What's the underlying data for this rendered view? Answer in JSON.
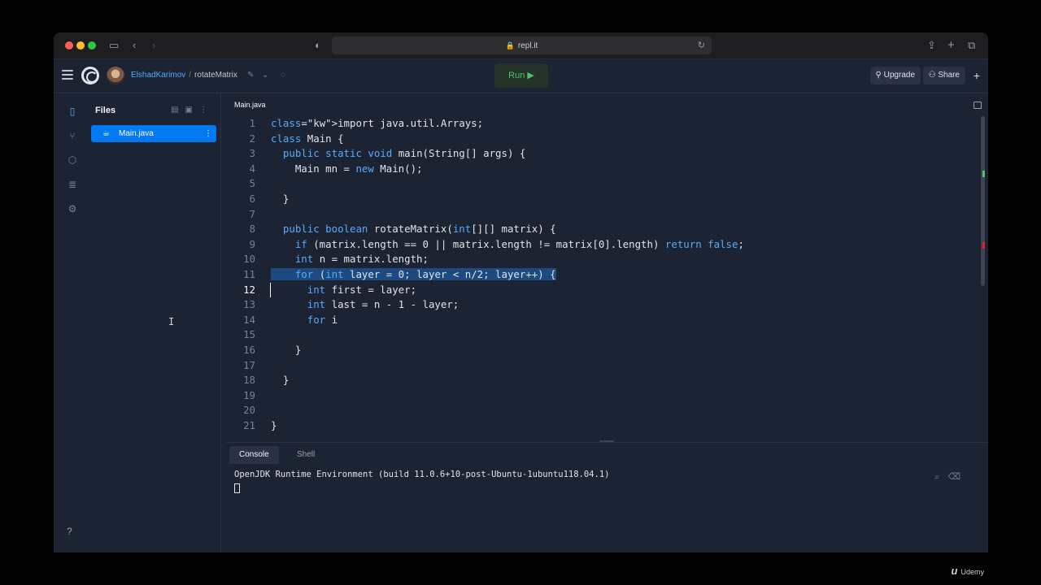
{
  "browser": {
    "url": "repl.it",
    "back_icon": "chevron-left-icon",
    "forward_icon": "chevron-right-icon"
  },
  "header": {
    "username": "ElshadKarimov",
    "separator": "/",
    "repl_name": "rotateMatrix",
    "run_label": "Run ▶",
    "upgrade_label": "Upgrade",
    "share_label": "Share"
  },
  "files": {
    "title": "Files",
    "items": [
      {
        "name": "Main.java"
      }
    ]
  },
  "editor": {
    "tab": "Main.java",
    "current_line": 12,
    "highlighted_line": 11,
    "lines": [
      "import java.util.Arrays;",
      "class Main {",
      "  public static void main(String[] args) {",
      "    Main mn = new Main();",
      "",
      "  }",
      "",
      "  public boolean rotateMatrix(int[][] matrix) {",
      "    if (matrix.length == 0 || matrix.length != matrix[0].length) return false;",
      "    int n = matrix.length;",
      "    for (int layer = 0; layer < n/2; layer++) {",
      "      int first = layer;",
      "      int last = n - 1 - layer;",
      "      for i",
      "",
      "    }",
      "",
      "  }",
      "",
      "",
      "}"
    ]
  },
  "console": {
    "tabs": [
      "Console",
      "Shell"
    ],
    "active_tab": "Console",
    "output": "OpenJDK Runtime Environment (build 11.0.6+10-post-Ubuntu-1ubuntu118.04.1)"
  },
  "watermark": "Udemy",
  "colors": {
    "accent": "#0079f2",
    "keyword": "#57abff",
    "run": "#4fc26a",
    "background": "#1c2333"
  }
}
